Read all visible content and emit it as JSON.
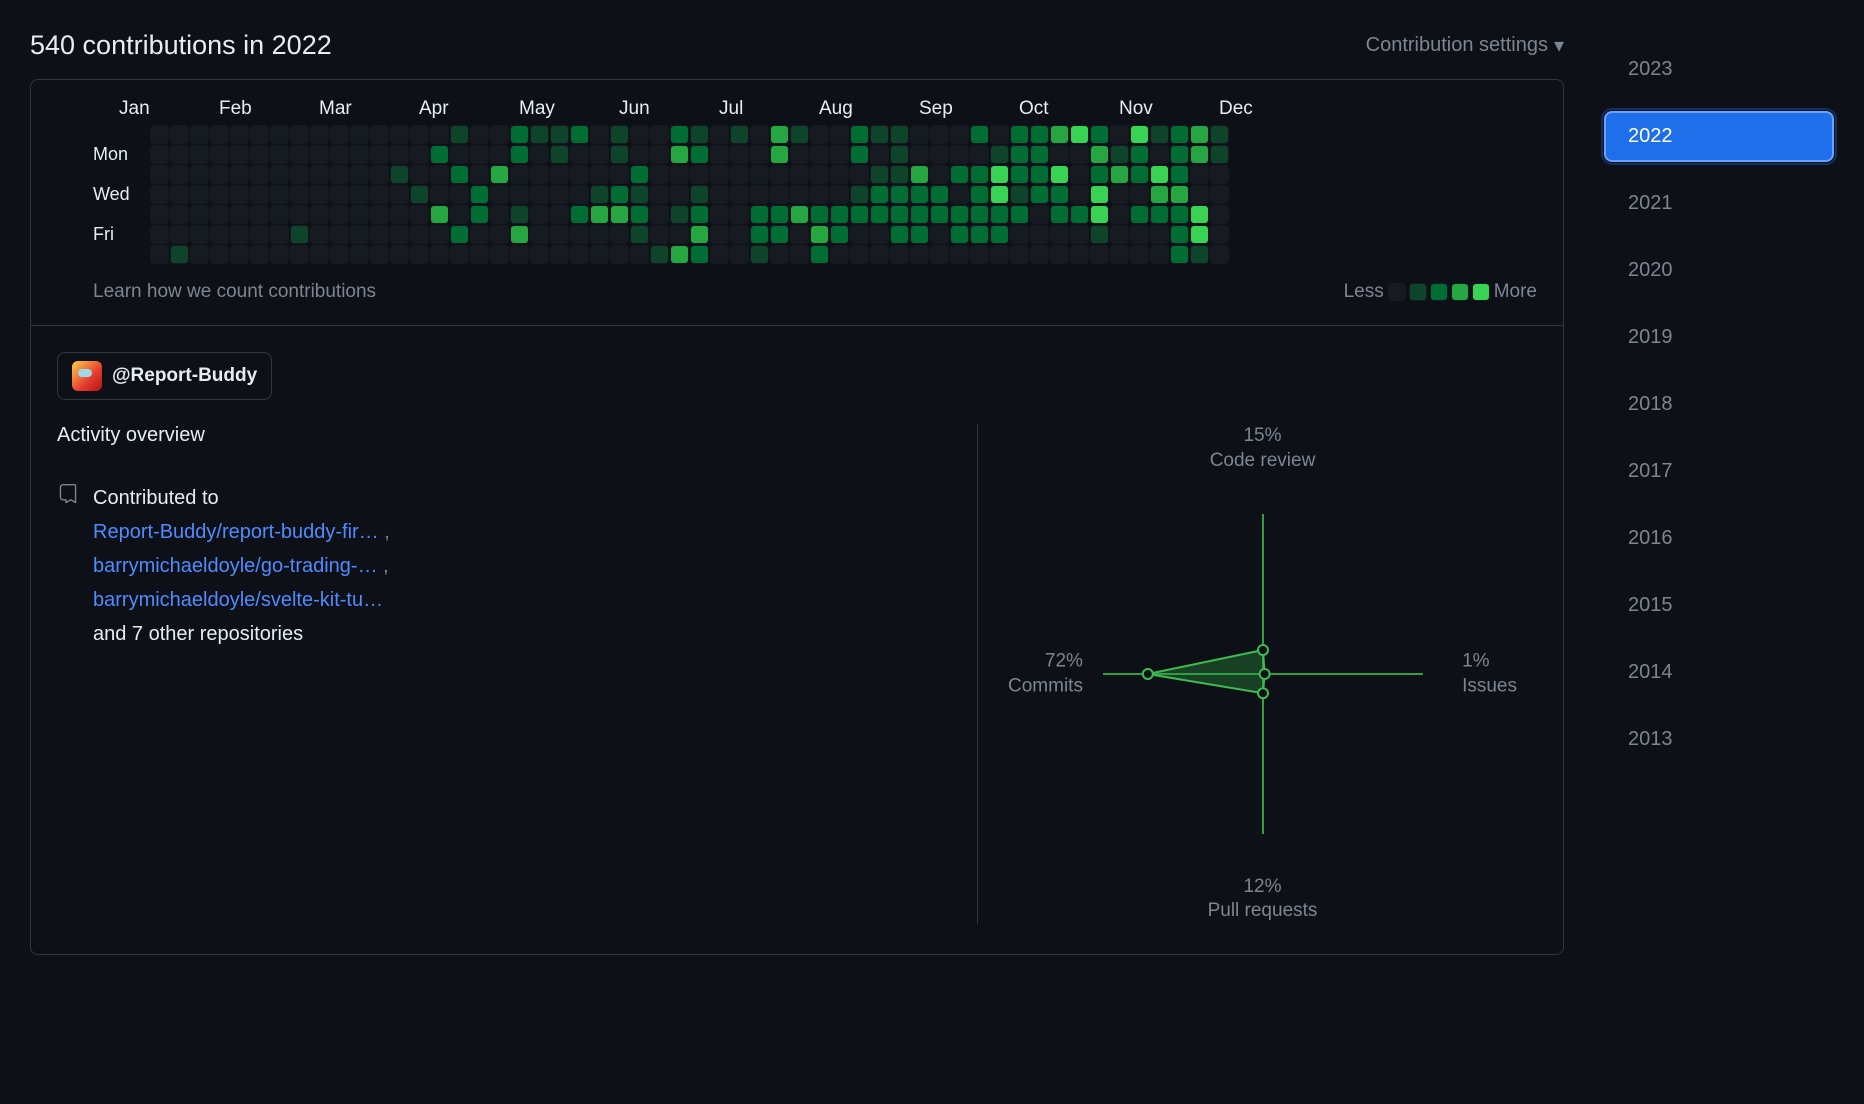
{
  "header": {
    "title": "540 contributions in 2022",
    "settings_label": "Contribution settings"
  },
  "calendar": {
    "months": [
      "Jan",
      "Feb",
      "Mar",
      "Apr",
      "May",
      "Jun",
      "Jul",
      "Aug",
      "Sep",
      "Oct",
      "Nov",
      "Dec"
    ],
    "day_labels": [
      "",
      "Mon",
      "",
      "Wed",
      "",
      "Fri",
      ""
    ],
    "learn_label": "Learn how we count contributions",
    "legend_less": "Less",
    "legend_more": "More"
  },
  "org_chip": {
    "handle": "@Report-Buddy"
  },
  "activity": {
    "title": "Activity overview",
    "contributed_label": "Contributed to",
    "repos": [
      "Report-Buddy/report-buddy-fir…",
      "barrymichaeldoyle/go-trading-…",
      "barrymichaeldoyle/svelte-kit-tu…"
    ],
    "repo_sep": ",",
    "others_label": "and 7 other repositories"
  },
  "chart_data": {
    "type": "radar",
    "axes": [
      {
        "key": "code_review",
        "label": "Code review",
        "percent": 15
      },
      {
        "key": "issues",
        "label": "Issues",
        "percent": 1
      },
      {
        "key": "pull_requests",
        "label": "Pull requests",
        "percent": 12
      },
      {
        "key": "commits",
        "label": "Commits",
        "percent": 72
      }
    ],
    "title": "",
    "max_percent": 100
  },
  "years": {
    "list": [
      "2023",
      "2022",
      "2021",
      "2020",
      "2019",
      "2018",
      "2017",
      "2016",
      "2015",
      "2014",
      "2013"
    ],
    "active": "2022"
  },
  "contrib_grid_levels": [
    [
      0,
      0,
      0,
      0,
      0,
      0,
      0,
      0,
      0,
      0,
      0,
      0,
      0,
      0,
      0,
      1,
      0,
      0,
      2,
      1,
      1,
      2,
      0,
      1,
      0,
      0,
      2,
      1,
      0,
      1,
      0,
      3,
      1,
      0,
      0,
      2,
      1,
      1,
      0,
      0,
      0,
      2,
      0,
      2,
      2,
      3,
      4,
      2,
      0,
      4,
      1,
      2,
      3,
      1
    ],
    [
      0,
      0,
      0,
      0,
      0,
      0,
      0,
      0,
      0,
      0,
      0,
      0,
      0,
      0,
      2,
      0,
      0,
      0,
      2,
      0,
      1,
      0,
      0,
      1,
      0,
      0,
      3,
      2,
      0,
      0,
      0,
      3,
      0,
      0,
      0,
      2,
      0,
      1,
      0,
      0,
      0,
      0,
      1,
      2,
      2,
      0,
      0,
      3,
      1,
      2,
      0,
      2,
      3,
      1
    ],
    [
      0,
      0,
      0,
      0,
      0,
      0,
      0,
      0,
      0,
      0,
      0,
      0,
      1,
      0,
      0,
      2,
      0,
      3,
      0,
      0,
      0,
      0,
      0,
      0,
      2,
      0,
      0,
      0,
      0,
      0,
      0,
      0,
      0,
      0,
      0,
      0,
      1,
      1,
      3,
      0,
      2,
      2,
      4,
      2,
      2,
      4,
      0,
      2,
      3,
      2,
      4,
      2,
      0,
      0
    ],
    [
      0,
      0,
      0,
      0,
      0,
      0,
      0,
      0,
      0,
      0,
      0,
      0,
      0,
      1,
      0,
      0,
      2,
      0,
      0,
      0,
      0,
      0,
      1,
      2,
      1,
      0,
      0,
      1,
      0,
      0,
      0,
      0,
      0,
      0,
      0,
      1,
      2,
      2,
      2,
      2,
      0,
      2,
      4,
      1,
      2,
      2,
      0,
      4,
      0,
      0,
      3,
      3,
      0,
      0
    ],
    [
      0,
      0,
      0,
      0,
      0,
      0,
      0,
      0,
      0,
      0,
      0,
      0,
      0,
      0,
      3,
      0,
      2,
      0,
      1,
      0,
      0,
      2,
      3,
      3,
      2,
      0,
      1,
      2,
      0,
      0,
      2,
      2,
      3,
      2,
      2,
      2,
      2,
      2,
      2,
      2,
      2,
      2,
      2,
      2,
      0,
      2,
      2,
      4,
      0,
      2,
      2,
      2,
      4,
      0
    ],
    [
      0,
      0,
      0,
      0,
      0,
      0,
      0,
      1,
      0,
      0,
      0,
      0,
      0,
      0,
      0,
      2,
      0,
      0,
      3,
      0,
      0,
      0,
      0,
      0,
      1,
      0,
      0,
      3,
      0,
      0,
      2,
      2,
      0,
      3,
      2,
      0,
      0,
      2,
      2,
      0,
      2,
      2,
      2,
      0,
      0,
      0,
      0,
      1,
      0,
      0,
      0,
      2,
      4,
      0
    ],
    [
      0,
      1,
      0,
      0,
      0,
      0,
      0,
      0,
      0,
      0,
      0,
      0,
      0,
      0,
      0,
      0,
      0,
      0,
      0,
      0,
      0,
      0,
      0,
      0,
      0,
      1,
      3,
      2,
      0,
      0,
      1,
      0,
      0,
      2,
      0,
      0,
      0,
      0,
      0,
      0,
      0,
      0,
      0,
      0,
      0,
      0,
      0,
      0,
      0,
      0,
      0,
      2,
      1,
      0
    ]
  ]
}
